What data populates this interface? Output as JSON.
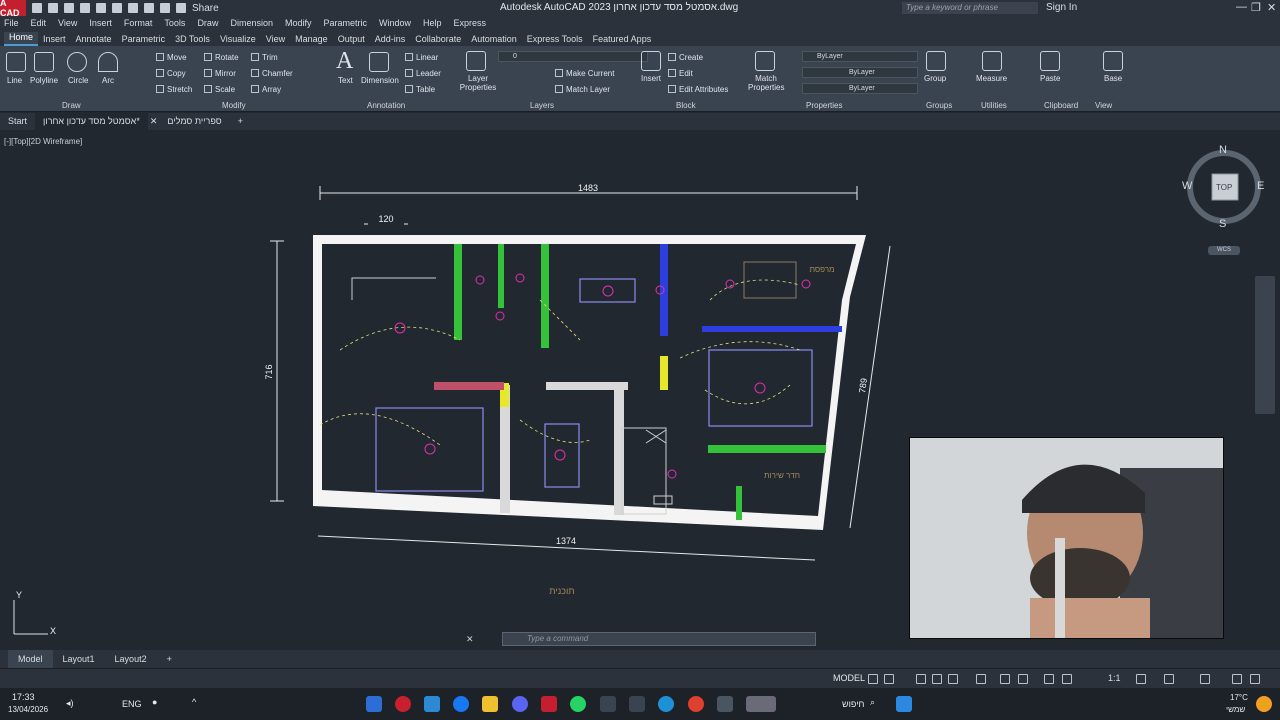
{
  "window": {
    "logo": "A CAD",
    "title": "Autodesk AutoCAD 2023   אסמטל מסד עדכון אחרון.dwg",
    "share": "Share",
    "search_placeholder": "Type a keyword or phrase",
    "sign_in": "Sign In"
  },
  "menu": [
    "File",
    "Edit",
    "View",
    "Insert",
    "Format",
    "Tools",
    "Draw",
    "Dimension",
    "Modify",
    "Parametric",
    "Window",
    "Help",
    "Express"
  ],
  "ribbon_tabs": [
    "Home",
    "Insert",
    "Annotate",
    "Parametric",
    "3D Tools",
    "Visualize",
    "View",
    "Manage",
    "Output",
    "Add-ins",
    "Collaborate",
    "Automation",
    "Express Tools",
    "Featured Apps"
  ],
  "ribbon": {
    "draw": {
      "line": "Line",
      "polyline": "Polyline",
      "circle": "Circle",
      "arc": "Arc",
      "label": "Draw"
    },
    "modify": {
      "move": "Move",
      "rotate": "Rotate",
      "trim": "Trim",
      "copy": "Copy",
      "mirror": "Mirror",
      "chamfer": "Chamfer",
      "stretch": "Stretch",
      "scale": "Scale",
      "array": "Array",
      "label": "Modify"
    },
    "annotation": {
      "text": "Text",
      "dimension": "Dimension",
      "linear": "Linear",
      "leader": "Leader",
      "table": "Table",
      "label": "Annotation"
    },
    "layers": {
      "properties": "Layer Properties",
      "current_layer": "0",
      "make_current": "Make Current",
      "match_layer": "Match Layer",
      "label": "Layers"
    },
    "block": {
      "insert": "Insert",
      "create": "Create",
      "edit": "Edit",
      "edit_attributes": "Edit Attributes",
      "label": "Block"
    },
    "properties": {
      "match": "Match Properties",
      "bylayer1": "ByLayer",
      "bylayer2": "ByLayer",
      "bylayer3": "ByLayer",
      "label": "Properties"
    },
    "groups": {
      "group": "Group",
      "label": "Groups"
    },
    "utilities": {
      "measure": "Measure",
      "label": "Utilities"
    },
    "clipboard": {
      "paste": "Paste",
      "label": "Clipboard"
    },
    "view": {
      "base": "Base",
      "label": "View"
    }
  },
  "file_tabs": {
    "start": "Start",
    "active": "אסמטל מסד עדכון אחרון*",
    "second": "ספריית סמלים"
  },
  "viewport_label": "[-][Top][2D Wireframe]",
  "drawing": {
    "dim_top": "1483",
    "dim_120": "120",
    "dim_left": "716",
    "dim_right": "789",
    "dim_bottom": "1374",
    "room_label_dining": "מרפסת",
    "room_label_bath": "חדר שירות",
    "bottom_label": "תוכנית"
  },
  "viewcube": {
    "north": "N",
    "south": "S",
    "east": "E",
    "west": "W",
    "face": "TOP",
    "wcs": "WCS"
  },
  "ucs": {
    "x": "X",
    "y": "Y"
  },
  "command_placeholder": "Type a command",
  "layout_tabs": [
    "Model",
    "Layout1",
    "Layout2"
  ],
  "status": {
    "model": "MODEL",
    "scale": "1:1"
  },
  "taskbar": {
    "time": "17:33",
    "date": "13/04/2026",
    "lang": "ENG",
    "weather_temp": "17°C",
    "weather_desc": "שמשי",
    "search": "חיפוש"
  }
}
